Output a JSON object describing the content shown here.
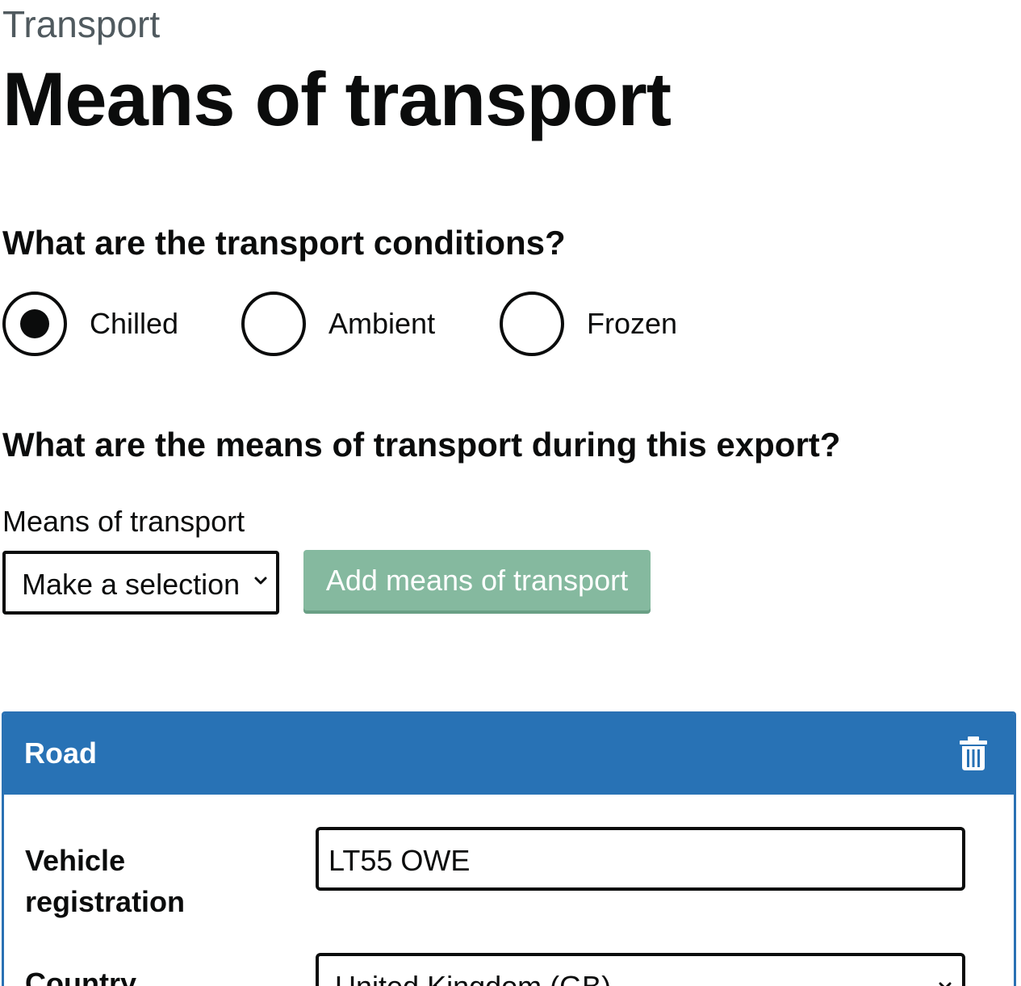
{
  "header": {
    "caption": "Transport",
    "title": "Means of transport"
  },
  "conditions": {
    "question": "What are the transport conditions?",
    "options": [
      {
        "label": "Chilled",
        "selected": true
      },
      {
        "label": "Ambient",
        "selected": false
      },
      {
        "label": "Frozen",
        "selected": false
      }
    ]
  },
  "means": {
    "question": "What are the means of transport during this export?",
    "select_label": "Means of transport",
    "select_value": "Make a selection",
    "add_button_label": "Add means of transport"
  },
  "road_panel": {
    "title": "Road",
    "delete_icon": "trash-icon",
    "vehicle_label": "Vehicle registration",
    "vehicle_value": "LT55 OWE",
    "country_label": "Country",
    "country_value": "United Kingdom (GB)"
  },
  "colors": {
    "panel_header": "#2872b5",
    "button_disabled": "#85b99f",
    "text": "#0b0c0c",
    "caption": "#505a5f"
  }
}
